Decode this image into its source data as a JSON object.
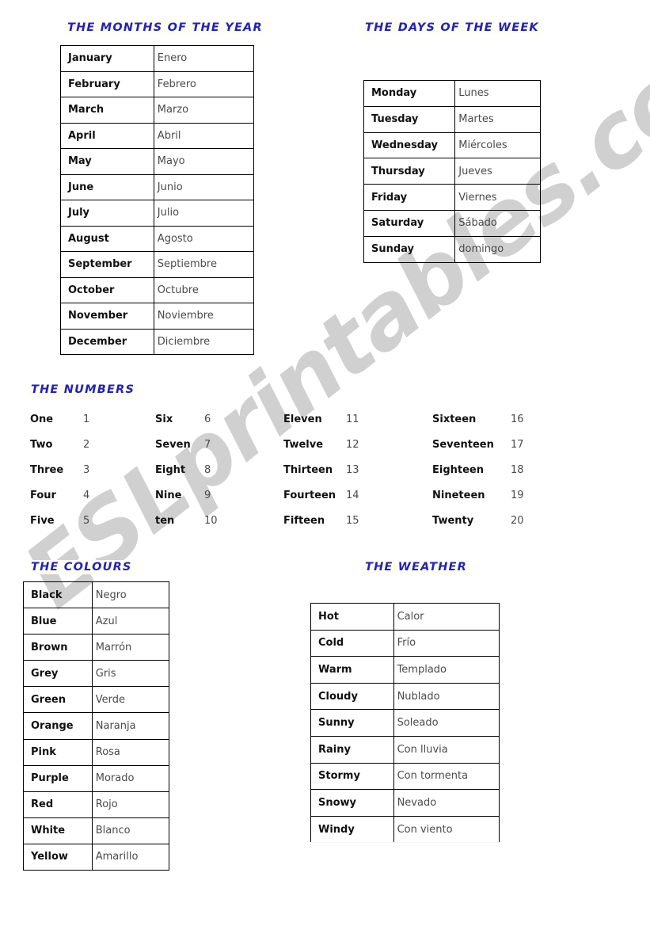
{
  "watermark": {
    "text": "ESLprintables.com"
  },
  "sections": {
    "months": {
      "title": "THE MONTHS OF THE YEAR",
      "rows": [
        {
          "en": "January",
          "es": "Enero"
        },
        {
          "en": "February",
          "es": "Febrero"
        },
        {
          "en": "March",
          "es": "Marzo"
        },
        {
          "en": "April",
          "es": "Abril"
        },
        {
          "en": "May",
          "es": "Mayo"
        },
        {
          "en": "June",
          "es": "Junio"
        },
        {
          "en": "July",
          "es": "Julio"
        },
        {
          "en": "August",
          "es": "Agosto"
        },
        {
          "en": "September",
          "es": "Septiembre"
        },
        {
          "en": "October",
          "es": "Octubre"
        },
        {
          "en": "November",
          "es": "Noviembre"
        },
        {
          "en": "December",
          "es": "Diciembre"
        }
      ]
    },
    "days": {
      "title": "THE DAYS OF THE WEEK",
      "rows": [
        {
          "en": "Monday",
          "es": "Lunes"
        },
        {
          "en": "Tuesday",
          "es": "Martes"
        },
        {
          "en": "Wednesday",
          "es": "Miércoles"
        },
        {
          "en": "Thursday",
          "es": "Jueves"
        },
        {
          "en": "Friday",
          "es": "Viernes"
        },
        {
          "en": "Saturday",
          "es": "Sábado"
        },
        {
          "en": "Sunday",
          "es": "domingo"
        }
      ]
    },
    "numbers": {
      "title": "THE NUMBERS",
      "columns": [
        [
          {
            "word": "One",
            "digit": "1"
          },
          {
            "word": "Two",
            "digit": "2"
          },
          {
            "word": "Three",
            "digit": "3"
          },
          {
            "word": "Four",
            "digit": "4"
          },
          {
            "word": "Five",
            "digit": "5"
          }
        ],
        [
          {
            "word": "Six",
            "digit": "6"
          },
          {
            "word": "Seven",
            "digit": "7"
          },
          {
            "word": "Eight",
            "digit": "8"
          },
          {
            "word": "Nine",
            "digit": "9"
          },
          {
            "word": "ten",
            "digit": "10"
          }
        ],
        [
          {
            "word": "Eleven",
            "digit": "11"
          },
          {
            "word": "Twelve",
            "digit": "12"
          },
          {
            "word": "Thirteen",
            "digit": "13"
          },
          {
            "word": "Fourteen",
            "digit": "14"
          },
          {
            "word": "Fifteen",
            "digit": "15"
          }
        ],
        [
          {
            "word": "Sixteen",
            "digit": "16"
          },
          {
            "word": "Seventeen",
            "digit": "17"
          },
          {
            "word": "Eighteen",
            "digit": "18"
          },
          {
            "word": "Nineteen",
            "digit": "19"
          },
          {
            "word": "Twenty",
            "digit": "20"
          }
        ]
      ]
    },
    "colours": {
      "title": "THE COLOURS",
      "rows": [
        {
          "en": "Black",
          "es": "Negro"
        },
        {
          "en": "Blue",
          "es": "Azul"
        },
        {
          "en": "Brown",
          "es": "Marrón"
        },
        {
          "en": "Grey",
          "es": "Gris"
        },
        {
          "en": "Green",
          "es": "Verde"
        },
        {
          "en": "Orange",
          "es": "Naranja"
        },
        {
          "en": "Pink",
          "es": "Rosa"
        },
        {
          "en": "Purple",
          "es": "Morado"
        },
        {
          "en": "Red",
          "es": "Rojo"
        },
        {
          "en": "White",
          "es": "Blanco"
        },
        {
          "en": "Yellow",
          "es": "Amarillo"
        }
      ]
    },
    "weather": {
      "title": "THE WEATHER",
      "rows": [
        {
          "en": "Hot",
          "es": "Calor"
        },
        {
          "en": "Cold",
          "es": "Frío"
        },
        {
          "en": "Warm",
          "es": "Templado"
        },
        {
          "en": "Cloudy",
          "es": "Nublado"
        },
        {
          "en": "Sunny",
          "es": "Soleado"
        },
        {
          "en": "Rainy",
          "es": "Con lluvia"
        },
        {
          "en": "Stormy",
          "es": "Con tormenta"
        },
        {
          "en": "Snowy",
          "es": "Nevado"
        },
        {
          "en": "Windy",
          "es": "Con viento"
        }
      ]
    }
  },
  "colors": {
    "title_blue": "#2222bb",
    "english_text": "#111111",
    "spanish_text": "#4a4a4a",
    "border": "#000000",
    "watermark_gray": "#c8c8c8",
    "page_background": "#ffffff"
  }
}
